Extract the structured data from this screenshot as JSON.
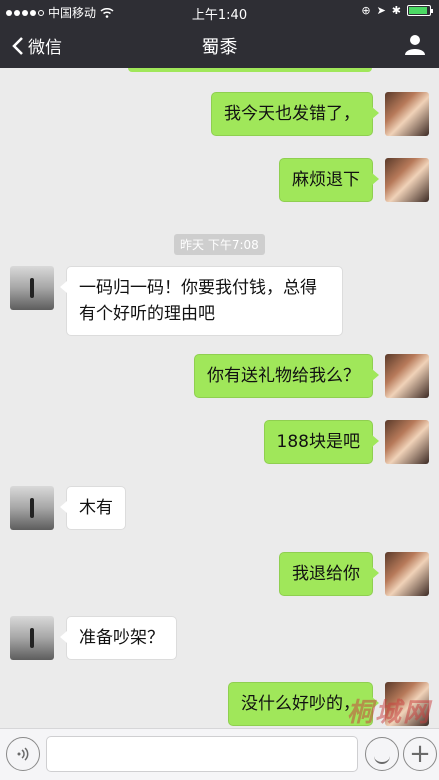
{
  "status_bar": {
    "carrier": "中国移动",
    "time": "上午1:40"
  },
  "nav": {
    "back_label": "微信",
    "title": "蜀黍",
    "profile_icon": "person-icon"
  },
  "chat": {
    "timestamp": "昨天 下午7:08",
    "messages": [
      {
        "sender": "me",
        "text": "我今天也发错了，"
      },
      {
        "sender": "me",
        "text": "麻烦退下"
      },
      {
        "sender": "other",
        "text": "一码归一码！你要我付钱，总得有个好听的理由吧"
      },
      {
        "sender": "me",
        "text": "你有送礼物给我么？"
      },
      {
        "sender": "me",
        "text": "188块是吧"
      },
      {
        "sender": "other",
        "text": "木有"
      },
      {
        "sender": "me",
        "text": "我退给你"
      },
      {
        "sender": "other",
        "text": "准备吵架？"
      },
      {
        "sender": "me",
        "text": "没什么好吵的，"
      }
    ]
  },
  "input_bar": {
    "voice_icon": "voice-icon",
    "emoji_icon": "emoji-icon",
    "plus_icon": "plus-icon",
    "plus_label": "+"
  },
  "watermark": "桐城网",
  "colors": {
    "my_bubble": "#a0e75a",
    "other_bubble": "#ffffff",
    "nav_bg": "#2e2e34",
    "chat_bg": "#ebebeb"
  }
}
